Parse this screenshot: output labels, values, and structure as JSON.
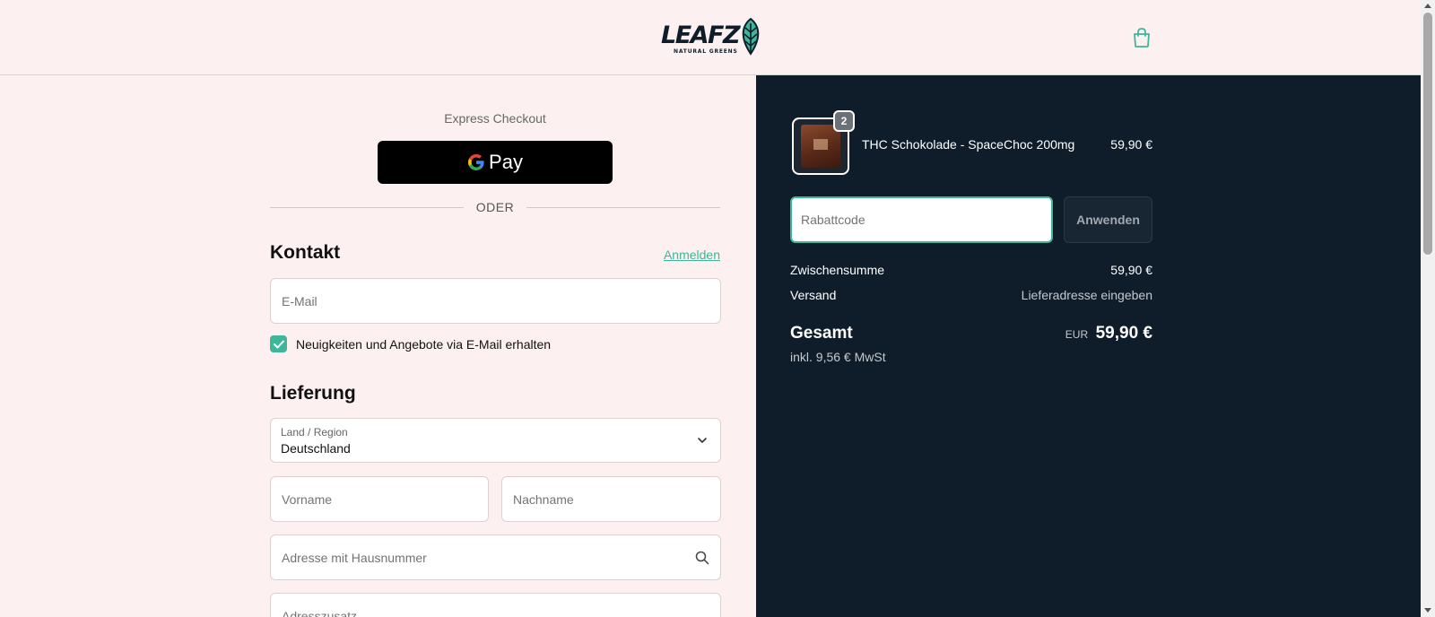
{
  "header": {
    "logo_text": "LEAFZ",
    "logo_subtitle": "NATURAL GREENS",
    "cart_icon": "shopping-bag-icon"
  },
  "express": {
    "label": "Express Checkout",
    "gpay_label": "Pay",
    "divider": "ODER"
  },
  "contact": {
    "title": "Kontakt",
    "login_link": "Anmelden",
    "email_placeholder": "E-Mail",
    "newsletter_label": "Neuigkeiten und Angebote via E-Mail erhalten",
    "newsletter_checked": true
  },
  "delivery": {
    "title": "Lieferung",
    "country_label": "Land / Region",
    "country_value": "Deutschland",
    "firstname_placeholder": "Vorname",
    "lastname_placeholder": "Nachname",
    "address_placeholder": "Adresse mit Hausnummer",
    "address2_placeholder": "Adresszusatz"
  },
  "summary": {
    "item": {
      "quantity": "2",
      "name": "THC Schokolade - SpaceChoc 200mg",
      "price": "59,90 €"
    },
    "discount_placeholder": "Rabattcode",
    "apply_label": "Anwenden",
    "subtotal_label": "Zwischensumme",
    "subtotal_value": "59,90 €",
    "shipping_label": "Versand",
    "shipping_value": "Lieferadresse eingeben",
    "total_label": "Gesamt",
    "total_currency": "EUR",
    "total_value": "59,90 €",
    "tax_note": "inkl. 9,56 € MwSt"
  },
  "colors": {
    "accent": "#3fb59a",
    "panel": "#0f1d2b",
    "background": "#fcf1f0"
  }
}
